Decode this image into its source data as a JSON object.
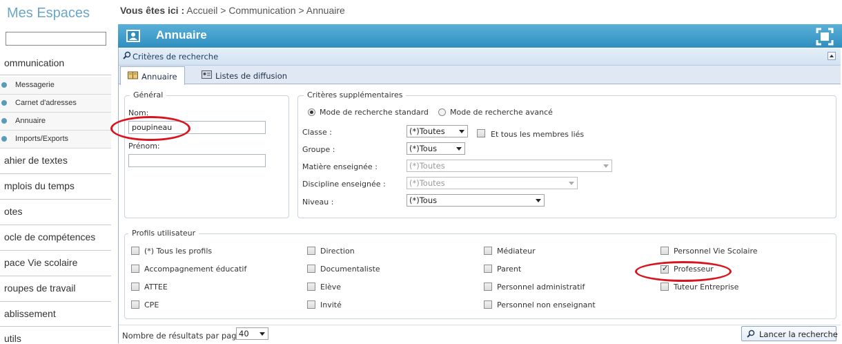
{
  "sidebar": {
    "title": "Mes Espaces",
    "search_value": "",
    "items": [
      {
        "label": "ommunication"
      },
      {
        "label": "ahier de textes"
      },
      {
        "label": "mplois du temps"
      },
      {
        "label": "otes"
      },
      {
        "label": "ocle de compétences"
      },
      {
        "label": "pace Vie scolaire"
      },
      {
        "label": "roupes de travail"
      },
      {
        "label": "ablissement"
      },
      {
        "label": "utils"
      }
    ],
    "subitems": [
      {
        "label": "Messagerie"
      },
      {
        "label": "Carnet d'adresses"
      },
      {
        "label": "Annuaire"
      },
      {
        "label": "Imports/Exports"
      }
    ]
  },
  "breadcrumb": {
    "prefix": "Vous êtes ici :",
    "path": "Accueil  > Communication  > Annuaire"
  },
  "header": {
    "title": "Annuaire"
  },
  "criteria_bar": {
    "label": "Critères de recherche"
  },
  "tabs": [
    {
      "label": "Annuaire"
    },
    {
      "label": "Listes de diffusion"
    }
  ],
  "general": {
    "legend": "Général",
    "nom_label": "Nom:",
    "nom_value": "poupineau",
    "prenom_label": "Prénom:",
    "prenom_value": ""
  },
  "extra": {
    "legend": "Critères supplémentaires",
    "mode_standard": "Mode de recherche standard",
    "mode_avance": "Mode de recherche avancé",
    "classe_label": "Classe :",
    "classe_value": "(*)Toutes",
    "all_members_label": "Et tous les membres liés",
    "groupe_label": "Groupe :",
    "groupe_value": "(*)Tous",
    "matiere_label": "Matière enseignée :",
    "matiere_value": "(*)Toutes",
    "discipline_label": "Discipline enseignée :",
    "discipline_value": "(*)Toutes",
    "niveau_label": "Niveau :",
    "niveau_value": "(*)Tous"
  },
  "profiles": {
    "legend": "Profils utilisateur",
    "items": [
      {
        "label": "(*) Tous les profils",
        "checked": false
      },
      {
        "label": "Direction",
        "checked": false
      },
      {
        "label": "Médiateur",
        "checked": false
      },
      {
        "label": "Personnel Vie Scolaire",
        "checked": false
      },
      {
        "label": "Accompagnement éducatif",
        "checked": false
      },
      {
        "label": "Documentaliste",
        "checked": false
      },
      {
        "label": "Parent",
        "checked": false
      },
      {
        "label": "Professeur",
        "checked": true
      },
      {
        "label": "ATTEE",
        "checked": false
      },
      {
        "label": "Elève",
        "checked": false
      },
      {
        "label": "Personnel administratif",
        "checked": false
      },
      {
        "label": "Tuteur Entreprise",
        "checked": false
      },
      {
        "label": "CPE",
        "checked": false
      },
      {
        "label": "Invité",
        "checked": false
      },
      {
        "label": "Personnel non enseignant",
        "checked": false
      }
    ]
  },
  "footer": {
    "results_label": "Nombre de résultats par page :",
    "results_value": "40",
    "search_button": "Lancer la recherche"
  },
  "colors": {
    "header_blue": "#2f8ec0",
    "sidebar_title": "#6aa6c9",
    "highlight_red": "#d9141f"
  }
}
